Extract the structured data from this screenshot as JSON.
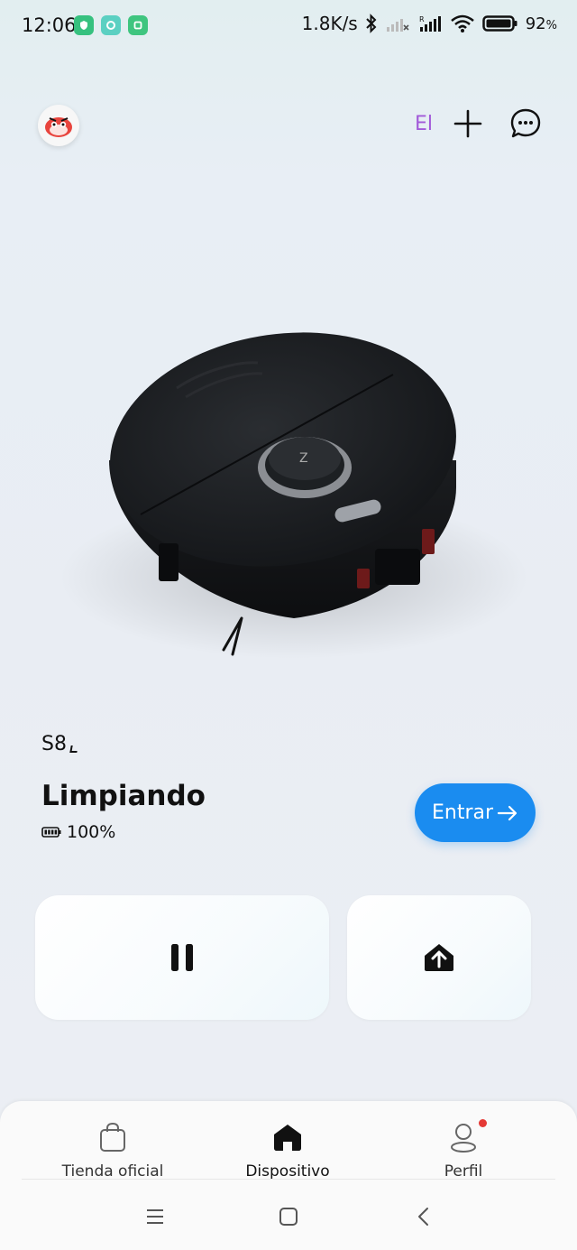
{
  "status_bar": {
    "time": "12:06",
    "speed": "1.8K/s",
    "battery": "92",
    "battery_suffix": "%"
  },
  "header": {
    "language": "El"
  },
  "device": {
    "name": "S8",
    "status": "Limpiando",
    "battery": "100%",
    "enter_label": "Entrar"
  },
  "bottom_nav": {
    "items": [
      {
        "label": "Tienda oficial",
        "icon": "shopping-bag-icon"
      },
      {
        "label": "Dispositivo",
        "icon": "home-icon"
      },
      {
        "label": "Perfil",
        "icon": "profile-icon"
      }
    ]
  },
  "colors": {
    "accent": "#1a8cf0",
    "lang": "#a25ad9",
    "notification_dot": "#e53935"
  }
}
